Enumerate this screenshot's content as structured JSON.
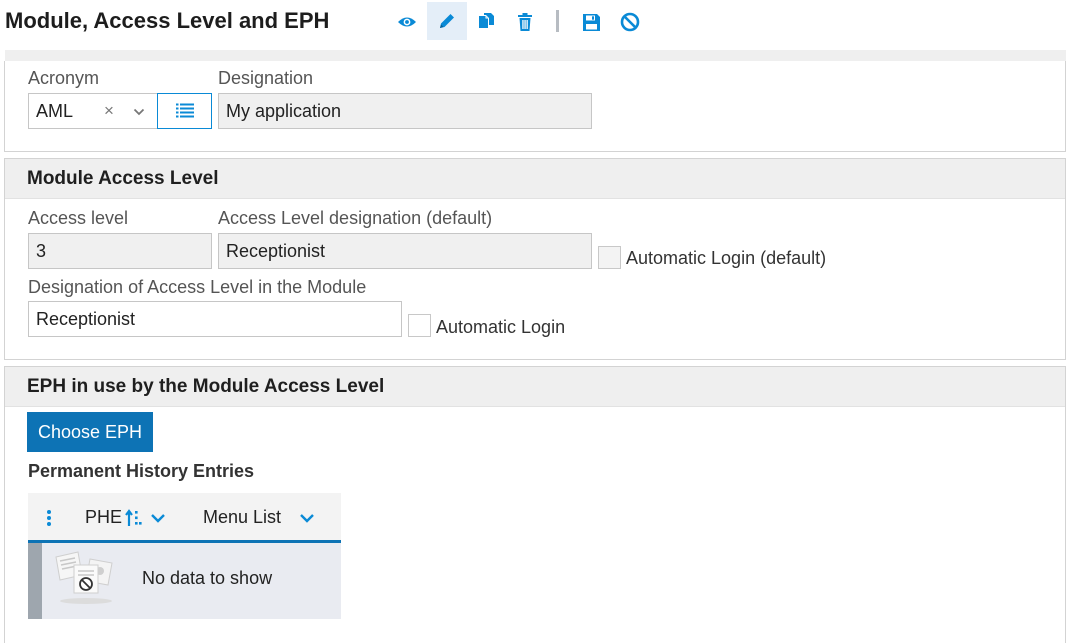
{
  "header": {
    "title": "Module, Access Level and EPH",
    "colors": {
      "accent": "#0d73b5",
      "icon": "#0a8ad6"
    }
  },
  "toolbar": {
    "icons": [
      "eye-icon",
      "pencil-icon",
      "copy-icon",
      "trash-icon",
      "save-icon",
      "cancel-icon"
    ]
  },
  "module": {
    "acronym_label": "Acronym",
    "acronym_value": "AML",
    "clear_symbol": "×",
    "designation_label": "Designation",
    "designation_value": "My application"
  },
  "access_level": {
    "section_title": "Module Access Level",
    "level_label": "Access level",
    "level_value": "3",
    "designation_default_label": "Access Level designation (default)",
    "designation_default_value": "Receptionist",
    "auto_login_default_label": "Automatic Login (default)",
    "module_designation_label": "Designation of Access Level in the Module",
    "module_designation_value": "Receptionist",
    "auto_login_label": "Automatic Login"
  },
  "eph": {
    "section_title": "EPH in use by the Module Access Level",
    "choose_button": "Choose EPH",
    "entries_title": "Permanent History Entries",
    "columns": [
      "PHE",
      "Menu List"
    ],
    "empty_text": "No data to show"
  }
}
